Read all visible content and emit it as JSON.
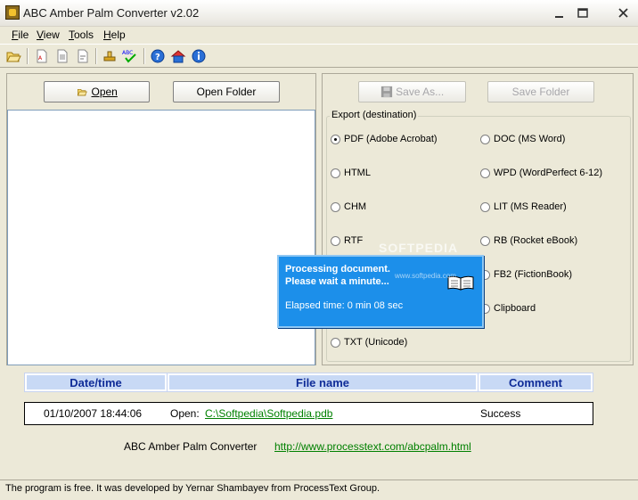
{
  "window": {
    "title": "ABC Amber Palm Converter v2.02",
    "controls": [
      "minimize",
      "maximize",
      "close"
    ]
  },
  "menu": [
    {
      "label": "File",
      "underline": "F",
      "rest": "ile"
    },
    {
      "label": "View",
      "underline": "V",
      "rest": "iew"
    },
    {
      "label": "Tools",
      "underline": "T",
      "rest": "ools"
    },
    {
      "label": "Help",
      "underline": "H",
      "rest": "elp"
    }
  ],
  "toolbar": {
    "icons": [
      "open-folder-icon",
      "pdf-doc-icon",
      "doc-icon",
      "rtf-doc-icon",
      "stamp-icon",
      "spellcheck-icon",
      "help-icon",
      "home-icon",
      "info-icon"
    ],
    "spell_label": "ABC"
  },
  "left_panel": {
    "open_label": "Open",
    "open_folder_label": "Open Folder"
  },
  "right_panel": {
    "save_as_label": "Save As...",
    "save_folder_label": "Save Folder",
    "group_title": "Export (destination)",
    "options_left": [
      "PDF (Adobe Acrobat)",
      "HTML",
      "CHM",
      "RTF",
      "",
      "",
      "TXT (Unicode)"
    ],
    "options_right": [
      "DOC (MS Word)",
      "WPD (WordPerfect 6-12)",
      "LIT (MS Reader)",
      "RB (Rocket eBook)",
      "FB2 (FictionBook)",
      "Clipboard"
    ],
    "selected": "PDF (Adobe Acrobat)"
  },
  "progress_popup": {
    "line1": "Processing document.",
    "line2": "Please wait a minute...",
    "elapsed": "Elapsed time: 0 min 08 sec",
    "watermark": "SOFTPEDIA",
    "watermark_url": "www.softpedia.com"
  },
  "log_table": {
    "columns": [
      "Date/time",
      "File name",
      "Comment"
    ],
    "rows": [
      {
        "datetime": "01/10/2007 18:44:06",
        "prefix": "Open:",
        "file": "C:\\Softpedia\\Softpedia.pdb",
        "comment": "Success"
      }
    ]
  },
  "footer": {
    "app_name": "ABC Amber Palm Converter",
    "url": "http://www.processtext.com/abcpalm.html"
  },
  "status_bar": "The program is free. It was developed by Yernar Shambayev from ProcessText Group.",
  "colors": {
    "window_bg": "#ece9d8",
    "popup_bg": "#1c8fea",
    "header_bg": "#c8d9f5",
    "header_text": "#0f2c98",
    "link": "#008000"
  }
}
